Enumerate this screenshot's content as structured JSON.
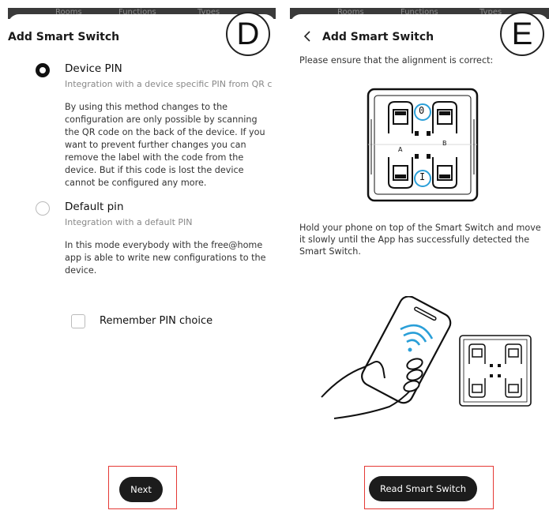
{
  "panel_d": {
    "tab_labels": [
      "Rooms",
      "Functions",
      "Types"
    ],
    "step_label": "D",
    "title": "Add Smart Switch",
    "option_device_pin": {
      "title": "Device PIN",
      "subtitle": "Integration with a device specific PIN from QR c",
      "description": "By using this method changes to the configuration are only possible by scanning the QR code on the back of the device. If you want to prevent further changes you can remove the label with the code from the device. But if this code is lost the device cannot be configured any more.",
      "selected": true
    },
    "option_default_pin": {
      "title": "Default pin",
      "subtitle": "Integration with a default PIN",
      "description": "In this mode everybody with the free@home app is able to write new configurations to the device.",
      "selected": false
    },
    "remember_checkbox": {
      "label": "Remember PIN choice",
      "checked": false
    },
    "next_button": "Next"
  },
  "panel_e": {
    "tab_labels": [
      "Rooms",
      "Functions",
      "Types"
    ],
    "step_label": "E",
    "back_icon": "chevron-left-icon",
    "title": "Add Smart Switch",
    "alignment_text": "Please ensure that the alignment is correct:",
    "switch_marks": {
      "top": "0",
      "bottom": "I",
      "left": "A",
      "right": "B"
    },
    "instruction_text": "Hold your phone on top of the Smart Switch and move it slowly until the App has successfully detected the Smart Switch.",
    "read_button": "Read Smart Switch"
  },
  "colors": {
    "highlight": "#e53935",
    "accent": "#2a9fd8",
    "button": "#1c1c1c"
  }
}
